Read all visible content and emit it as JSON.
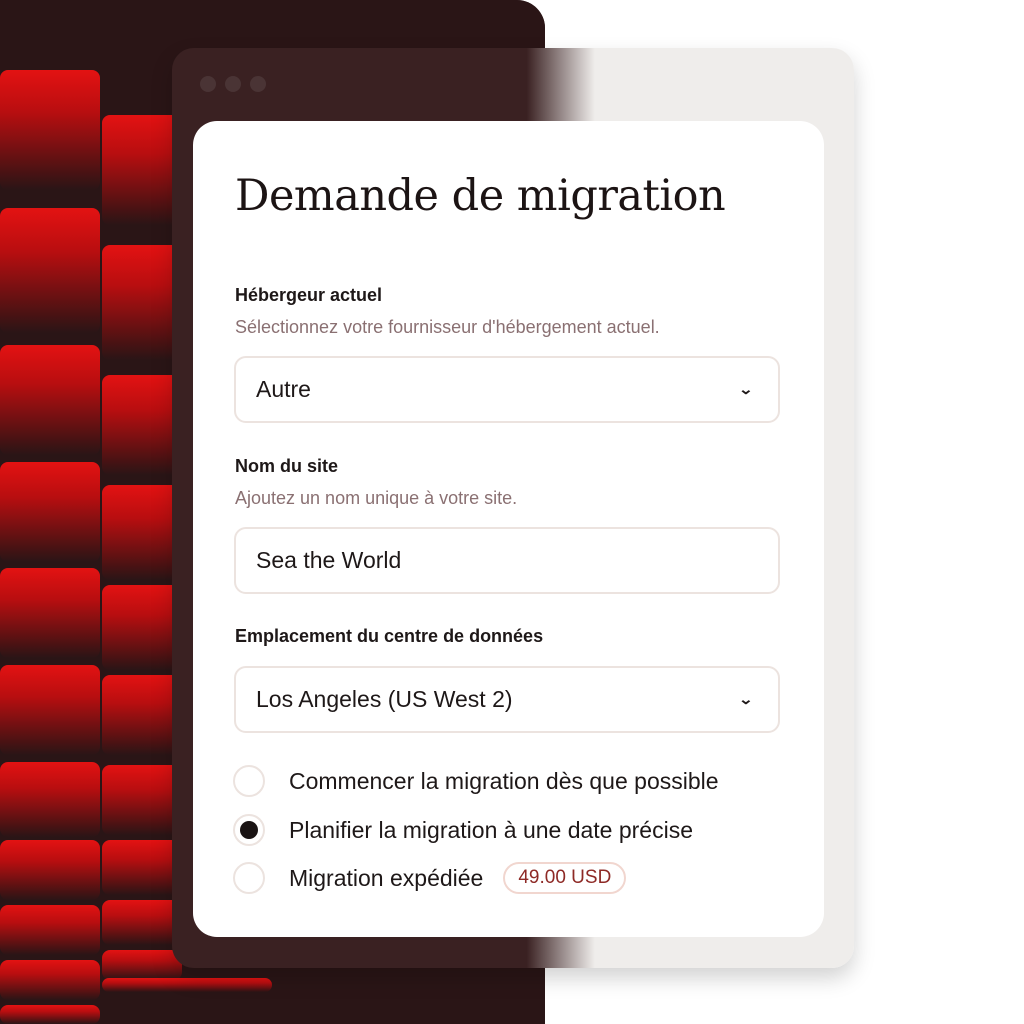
{
  "form": {
    "title": "Demande de migration",
    "host": {
      "label": "Hébergeur actuel",
      "hint": "Sélectionnez votre fournisseur d'hébergement actuel.",
      "value": "Autre"
    },
    "site": {
      "label": "Nom du site",
      "hint": "Ajoutez un nom unique à votre site.",
      "value": "Sea the World"
    },
    "datacenter": {
      "label": "Emplacement du centre de données",
      "value": "Los Angeles (US West 2)"
    },
    "options": [
      {
        "label": "Commencer la migration dès que possible",
        "selected": false
      },
      {
        "label": "Planifier la migration à une date précise",
        "selected": true
      },
      {
        "label": "Migration expédiée",
        "selected": false,
        "price": "49.00 USD"
      }
    ]
  },
  "icons": {
    "dropdown": "chevron-down-icon"
  },
  "colors": {
    "accent": "#e31212",
    "backdrop": "#2a1516",
    "price_text": "#8e2a26"
  }
}
